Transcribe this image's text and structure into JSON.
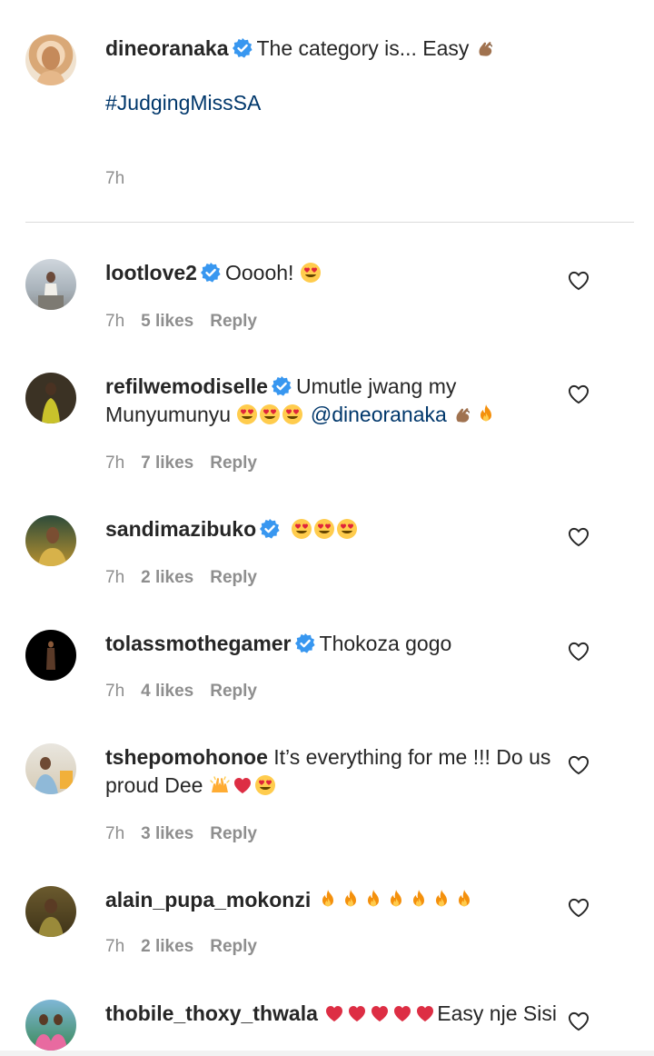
{
  "caption": {
    "username": "dineoranaka",
    "text": "The category is... Easy",
    "hashtag": "#JudgingMissSA",
    "time": "7h"
  },
  "reply_label": "Reply",
  "comments": [
    {
      "username": "lootlove2",
      "text": "Ooooh!",
      "time": "7h",
      "likes": "5 likes"
    },
    {
      "username": "refilwemodiselle",
      "text": "Umutle jwang my Munyumunyu",
      "mention": "@dineoranaka",
      "time": "7h",
      "likes": "7 likes"
    },
    {
      "username": "sandimazibuko",
      "text": "",
      "time": "7h",
      "likes": "2 likes"
    },
    {
      "username": "tolassmothegamer",
      "text": "Thokoza gogo",
      "time": "7h",
      "likes": "4 likes"
    },
    {
      "username": "tshepomohonoe",
      "text": "It’s everything for me !!! Do us proud Dee",
      "time": "7h",
      "likes": "3 likes"
    },
    {
      "username": "alain_pupa_mokonzi",
      "text": "",
      "time": "7h",
      "likes": "2 likes"
    },
    {
      "username": "thobile_thoxy_thwala",
      "text": "Easy nje Sisi"
    }
  ],
  "icons": {
    "verified": "verified-badge-icon",
    "heart": "heart-outline-icon",
    "pinch": "pinching-hand-emoji",
    "heart_eyes": "heart-eyes-emoji",
    "fire": "fire-emoji",
    "red_heart": "red-heart-emoji",
    "raised_hands": "raised-hands-emoji"
  },
  "colors": {
    "verified": "#3897f0",
    "link": "#00376b",
    "muted": "#8e8e8e",
    "text": "#262626"
  }
}
